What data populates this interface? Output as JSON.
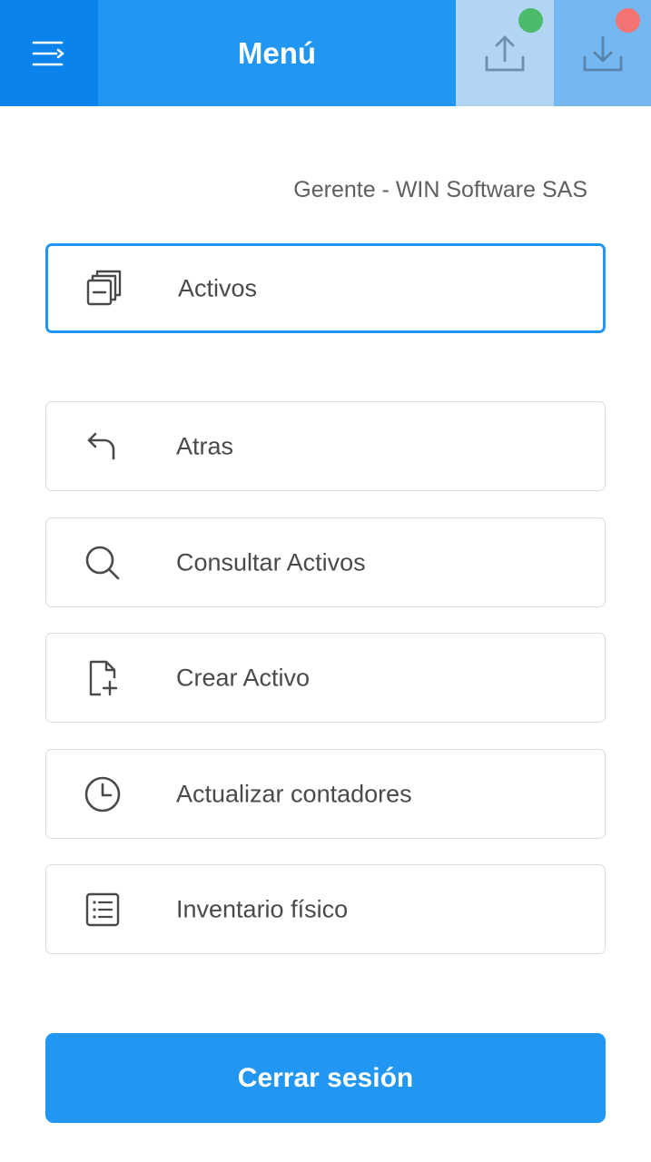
{
  "header": {
    "title": "Menú",
    "menu_icon": "menu-icon",
    "upload_icon": "upload-icon",
    "download_icon": "download-icon",
    "upload_status_color": "#4cba6b",
    "download_status_color": "#f37472"
  },
  "user": {
    "label": "Gerente - WIN Software SAS"
  },
  "menu": {
    "items": [
      {
        "label": "Activos",
        "icon": "copy-icon",
        "active": true
      },
      {
        "label": "Atras",
        "icon": "back-arrow-icon"
      },
      {
        "label": "Consultar Activos",
        "icon": "search-icon"
      },
      {
        "label": "Crear Activo",
        "icon": "file-add-icon"
      },
      {
        "label": "Actualizar contadores",
        "icon": "clock-icon"
      },
      {
        "label": "Inventario físico",
        "icon": "list-icon"
      }
    ]
  },
  "footer": {
    "logout_label": "Cerrar sesión"
  },
  "colors": {
    "primary": "#2196f3",
    "text": "#4a4a4a"
  }
}
